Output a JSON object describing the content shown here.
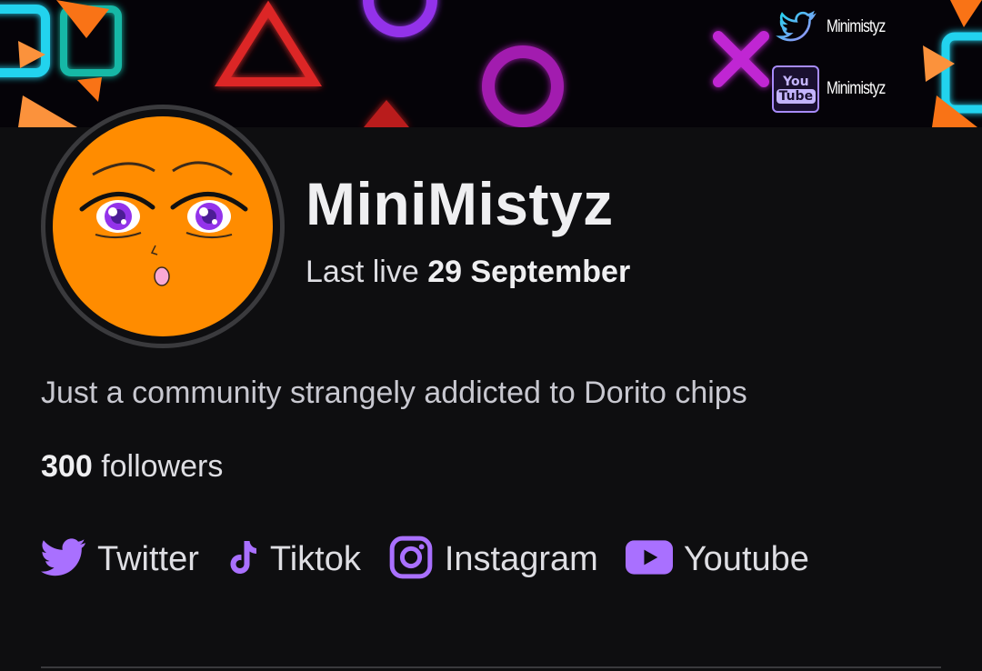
{
  "banner": {
    "twitter_handle": "Minimistyz",
    "youtube_handle": "Minimistyz",
    "youtube_badge_top": "You",
    "youtube_badge_bottom": "Tube"
  },
  "channel": {
    "name": "MiniMistyz",
    "last_live_prefix": "Last live",
    "last_live_date": "29 September",
    "description": "Just a community strangely addicted to Dorito chips",
    "followers_count": "300",
    "followers_label": "followers"
  },
  "social_links": [
    {
      "label": "Twitter",
      "icon": "twitter-icon"
    },
    {
      "label": "Tiktok",
      "icon": "tiktok-icon"
    },
    {
      "label": "Instagram",
      "icon": "instagram-icon"
    },
    {
      "label": "Youtube",
      "icon": "youtube-icon"
    }
  ],
  "colors": {
    "background": "#0e0e10",
    "accent": "#9147ff",
    "avatar_orange": "#ff8c00",
    "text_primary": "#efeff1"
  }
}
